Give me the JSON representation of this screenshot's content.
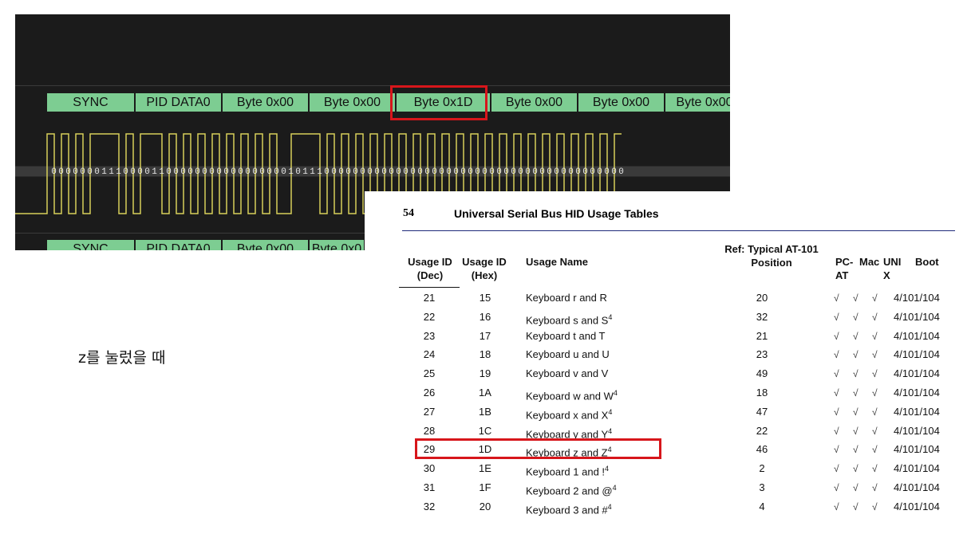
{
  "analyzer": {
    "frame_top": [
      "SYNC",
      "PID DATA0",
      "Byte 0x00",
      "Byte 0x00",
      "Byte 0x1D",
      "Byte 0x00",
      "Byte 0x00",
      "Byte 0x00"
    ],
    "frame_bottom": [
      "SYNC",
      "PID DATA0",
      "Byte 0x00",
      "Byte 0x0"
    ],
    "bits": "00000001110000110000000000000000010111000000000000000000000000000000000000000000",
    "highlighted_field": "Byte 0x1D"
  },
  "document": {
    "page_number": "54",
    "title": "Universal Serial Bus HID Usage Tables",
    "headers": {
      "dec": "Usage ID (Dec)",
      "hex": "Usage ID (Hex)",
      "name": "Usage Name",
      "ref": "Ref: Typical AT-101 Position",
      "pcat": "PC-AT",
      "mac": "Mac",
      "unix": "UNI X",
      "boot": "Boot"
    },
    "rows": [
      {
        "dec": "21",
        "hex": "15",
        "name": "Keyboard r and R",
        "sup": "",
        "pos": "20",
        "pcat": "√",
        "mac": "√",
        "unix": "√",
        "boot": "4/101/104"
      },
      {
        "dec": "22",
        "hex": "16",
        "name": "Keyboard s and S",
        "sup": "4",
        "pos": "32",
        "pcat": "√",
        "mac": "√",
        "unix": "√",
        "boot": "4/101/104"
      },
      {
        "dec": "23",
        "hex": "17",
        "name": "Keyboard t and T",
        "sup": "",
        "pos": "21",
        "pcat": "√",
        "mac": "√",
        "unix": "√",
        "boot": "4/101/104"
      },
      {
        "dec": "24",
        "hex": "18",
        "name": "Keyboard u and U",
        "sup": "",
        "pos": "23",
        "pcat": "√",
        "mac": "√",
        "unix": "√",
        "boot": "4/101/104"
      },
      {
        "dec": "25",
        "hex": "19",
        "name": "Keyboard v and V",
        "sup": "",
        "pos": "49",
        "pcat": "√",
        "mac": "√",
        "unix": "√",
        "boot": "4/101/104"
      },
      {
        "dec": "26",
        "hex": "1A",
        "name": "Keyboard w and W",
        "sup": "4",
        "pos": "18",
        "pcat": "√",
        "mac": "√",
        "unix": "√",
        "boot": "4/101/104"
      },
      {
        "dec": "27",
        "hex": "1B",
        "name": "Keyboard x and X",
        "sup": "4",
        "pos": "47",
        "pcat": "√",
        "mac": "√",
        "unix": "√",
        "boot": "4/101/104"
      },
      {
        "dec": "28",
        "hex": "1C",
        "name": "Keyboard y and Y",
        "sup": "4",
        "pos": "22",
        "pcat": "√",
        "mac": "√",
        "unix": "√",
        "boot": "4/101/104"
      },
      {
        "dec": "29",
        "hex": "1D",
        "name": "Keyboard z and Z",
        "sup": "4",
        "pos": "46",
        "pcat": "√",
        "mac": "√",
        "unix": "√",
        "boot": "4/101/104"
      },
      {
        "dec": "30",
        "hex": "1E",
        "name": "Keyboard 1 and !",
        "sup": "4",
        "pos": "2",
        "pcat": "√",
        "mac": "√",
        "unix": "√",
        "boot": "4/101/104"
      },
      {
        "dec": "31",
        "hex": "1F",
        "name": "Keyboard 2 and @",
        "sup": "4",
        "pos": "3",
        "pcat": "√",
        "mac": "√",
        "unix": "√",
        "boot": "4/101/104"
      },
      {
        "dec": "32",
        "hex": "20",
        "name": "Keyboard 3 and #",
        "sup": "4",
        "pos": "4",
        "pcat": "√",
        "mac": "√",
        "unix": "√",
        "boot": "4/101/104"
      }
    ],
    "highlighted_row": "29"
  },
  "note": "z를 눌렀을 때",
  "colors": {
    "analyzer_bg": "#1b1b1b",
    "frame_fill": "#7dcd92",
    "signal": "#d8cf5a",
    "highlight": "#d7161b",
    "doc_rule": "#1f2a7a"
  }
}
